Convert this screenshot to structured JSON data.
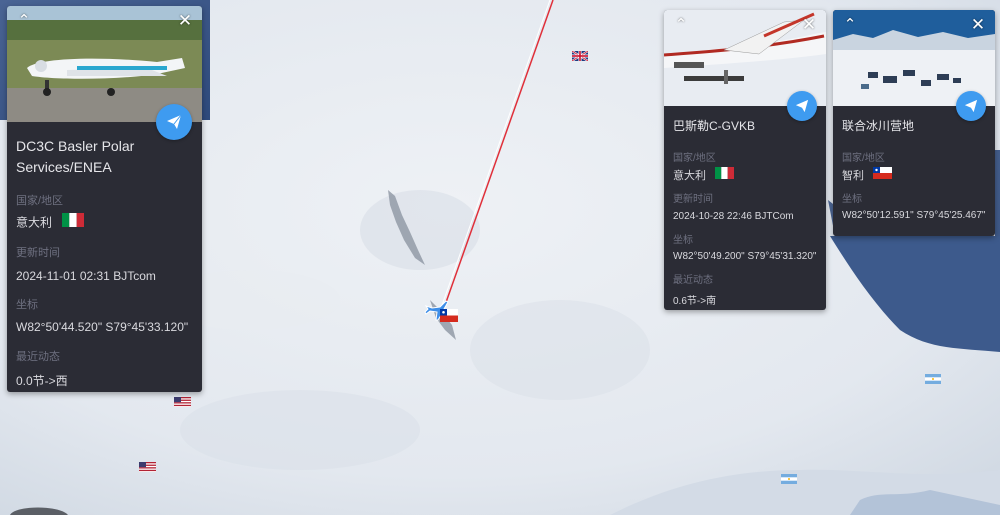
{
  "cards": [
    {
      "name": "DC3C Basler Polar Services/ENEA",
      "country_label": "国家/地区",
      "country": "意大利",
      "flag": "italy-flag",
      "time_label": "更新时间",
      "time": "2024-11-01 02:31 BJTcom",
      "coord_label": "坐标",
      "coord": "W82°50'44.520\" S79°45'33.120\"",
      "status_label": "最近动态",
      "status": "0.0节->西"
    },
    {
      "name": "巴斯勒C-GVKB",
      "country_label": "国家/地区",
      "country": "意大利",
      "flag": "italy-flag",
      "time_label": "更新时间",
      "time": "2024-10-28 22:46 BJTCom",
      "coord_label": "坐标",
      "coord": "W82°50'49.200\" S79°45'31.320\"",
      "status_label": "最近动态",
      "status": "0.6节->南"
    },
    {
      "name": "联合冰川营地",
      "country_label": "国家/地区",
      "country": "智利",
      "flag": "chile-flag",
      "coord_label": "坐标",
      "coord": "W82°50'12.591\" S79°45'25.467\""
    }
  ],
  "icons": {
    "collapse": "chevron-up-icon",
    "close": "close-icon",
    "send": "paper-plane-icon"
  },
  "map_flags": [
    "uk-flag",
    "usa-flag",
    "usa-flag",
    "argentina-flag",
    "argentina-flag",
    "chile-flag"
  ],
  "colors": {
    "card_bg": "#2b2c35",
    "accent": "#3e9bf0",
    "track_line": "#e0303a"
  }
}
